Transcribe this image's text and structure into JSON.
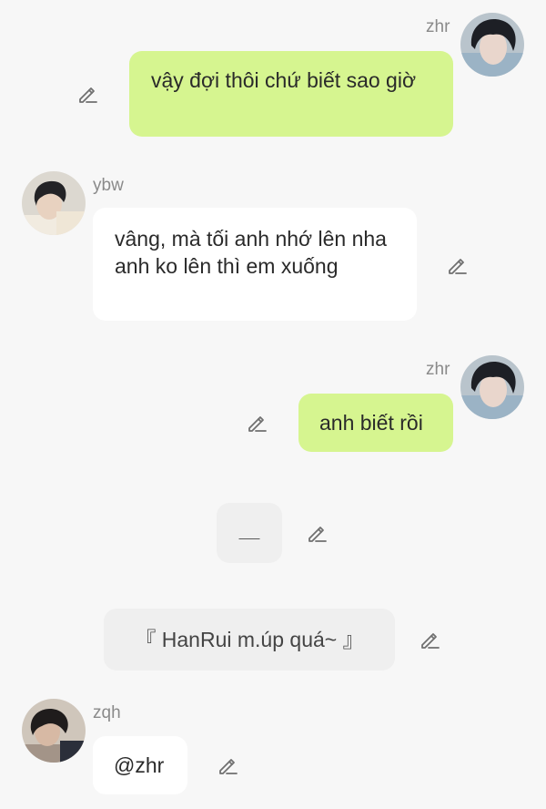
{
  "messages": [
    {
      "sender": "zhr",
      "text": "vậy đợi thôi chứ biết sao giờ"
    },
    {
      "sender": "ybw",
      "text": "vâng, mà tối anh nhớ lên nha anh ko lên thì em xuống"
    },
    {
      "sender": "zhr",
      "text": "anh biết rồi"
    },
    {
      "text": "＿"
    },
    {
      "text": "『 HanRui m.úp quá~ 』"
    },
    {
      "sender": "zqh",
      "text": "@zhr"
    }
  ],
  "icons": {
    "edit": "pencil-icon"
  },
  "colors": {
    "background": "#f7f7f7",
    "bubble_self": "#d6f590",
    "bubble_other": "#ffffff",
    "bubble_system": "#efefef",
    "name_text": "#8a8a8a"
  }
}
